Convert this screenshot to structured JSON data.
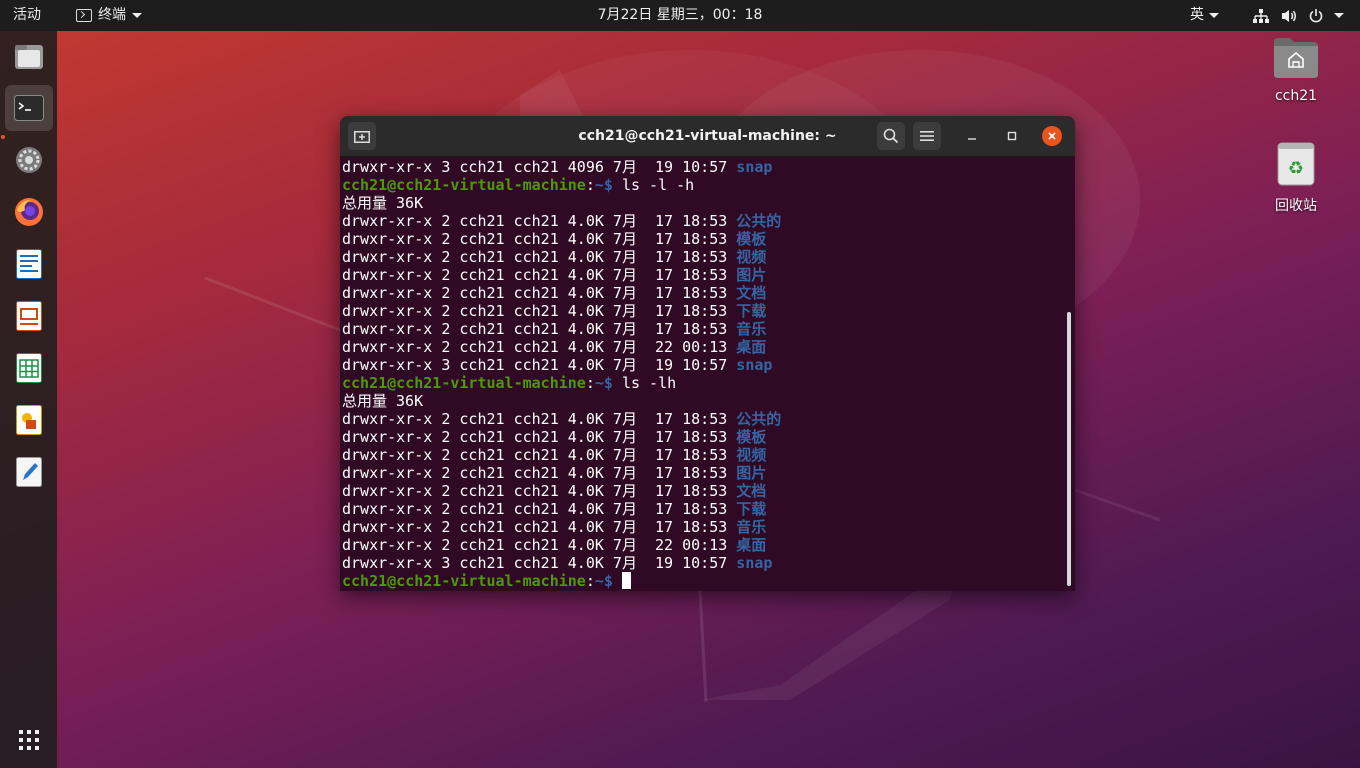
{
  "topbar": {
    "activities": "活动",
    "app_name": "终端",
    "clock": "7月22日 星期三，00：18",
    "input_method": "英"
  },
  "dock": {
    "items": [
      {
        "name": "files"
      },
      {
        "name": "terminal",
        "active": true
      },
      {
        "name": "settings"
      },
      {
        "name": "firefox"
      },
      {
        "name": "libreoffice-writer"
      },
      {
        "name": "libreoffice-impress"
      },
      {
        "name": "libreoffice-calc"
      },
      {
        "name": "libreoffice-draw"
      },
      {
        "name": "text-editor"
      },
      {
        "name": "show-applications"
      }
    ]
  },
  "desktop": {
    "home_label": "cch21",
    "trash_label": "回收站"
  },
  "terminal": {
    "title": "cch21@cch21-virtual-machine: ~",
    "prompt_user": "cch21@cch21-virtual-machine",
    "prompt_sep": ":",
    "prompt_path": "~$",
    "lines": [
      {
        "type": "entry",
        "meta": "drwxr-xr-x 3 cch21 cch21 4096 7月  19 10:57 ",
        "name": "snap"
      },
      {
        "type": "prompt",
        "cmd": " ls -l -h"
      },
      {
        "type": "text",
        "text": "总用量 36K"
      },
      {
        "type": "entry",
        "meta": "drwxr-xr-x 2 cch21 cch21 4.0K 7月  17 18:53 ",
        "name": "公共的"
      },
      {
        "type": "entry",
        "meta": "drwxr-xr-x 2 cch21 cch21 4.0K 7月  17 18:53 ",
        "name": "模板"
      },
      {
        "type": "entry",
        "meta": "drwxr-xr-x 2 cch21 cch21 4.0K 7月  17 18:53 ",
        "name": "视频"
      },
      {
        "type": "entry",
        "meta": "drwxr-xr-x 2 cch21 cch21 4.0K 7月  17 18:53 ",
        "name": "图片"
      },
      {
        "type": "entry",
        "meta": "drwxr-xr-x 2 cch21 cch21 4.0K 7月  17 18:53 ",
        "name": "文档"
      },
      {
        "type": "entry",
        "meta": "drwxr-xr-x 2 cch21 cch21 4.0K 7月  17 18:53 ",
        "name": "下载"
      },
      {
        "type": "entry",
        "meta": "drwxr-xr-x 2 cch21 cch21 4.0K 7月  17 18:53 ",
        "name": "音乐"
      },
      {
        "type": "entry",
        "meta": "drwxr-xr-x 2 cch21 cch21 4.0K 7月  22 00:13 ",
        "name": "桌面"
      },
      {
        "type": "entry",
        "meta": "drwxr-xr-x 3 cch21 cch21 4.0K 7月  19 10:57 ",
        "name": "snap"
      },
      {
        "type": "prompt",
        "cmd": " ls -lh"
      },
      {
        "type": "text",
        "text": "总用量 36K"
      },
      {
        "type": "entry",
        "meta": "drwxr-xr-x 2 cch21 cch21 4.0K 7月  17 18:53 ",
        "name": "公共的"
      },
      {
        "type": "entry",
        "meta": "drwxr-xr-x 2 cch21 cch21 4.0K 7月  17 18:53 ",
        "name": "模板"
      },
      {
        "type": "entry",
        "meta": "drwxr-xr-x 2 cch21 cch21 4.0K 7月  17 18:53 ",
        "name": "视频"
      },
      {
        "type": "entry",
        "meta": "drwxr-xr-x 2 cch21 cch21 4.0K 7月  17 18:53 ",
        "name": "图片"
      },
      {
        "type": "entry",
        "meta": "drwxr-xr-x 2 cch21 cch21 4.0K 7月  17 18:53 ",
        "name": "文档"
      },
      {
        "type": "entry",
        "meta": "drwxr-xr-x 2 cch21 cch21 4.0K 7月  17 18:53 ",
        "name": "下载"
      },
      {
        "type": "entry",
        "meta": "drwxr-xr-x 2 cch21 cch21 4.0K 7月  17 18:53 ",
        "name": "音乐"
      },
      {
        "type": "entry",
        "meta": "drwxr-xr-x 2 cch21 cch21 4.0K 7月  22 00:13 ",
        "name": "桌面"
      },
      {
        "type": "entry",
        "meta": "drwxr-xr-x 3 cch21 cch21 4.0K 7月  19 10:57 ",
        "name": "snap"
      },
      {
        "type": "prompt",
        "cmd": " ",
        "cursor": true
      }
    ]
  },
  "colors": {
    "terminal_bg": "#300a24",
    "prompt_green": "#4e9a06",
    "dir_blue": "#3465a4",
    "accent_orange": "#e95420"
  }
}
